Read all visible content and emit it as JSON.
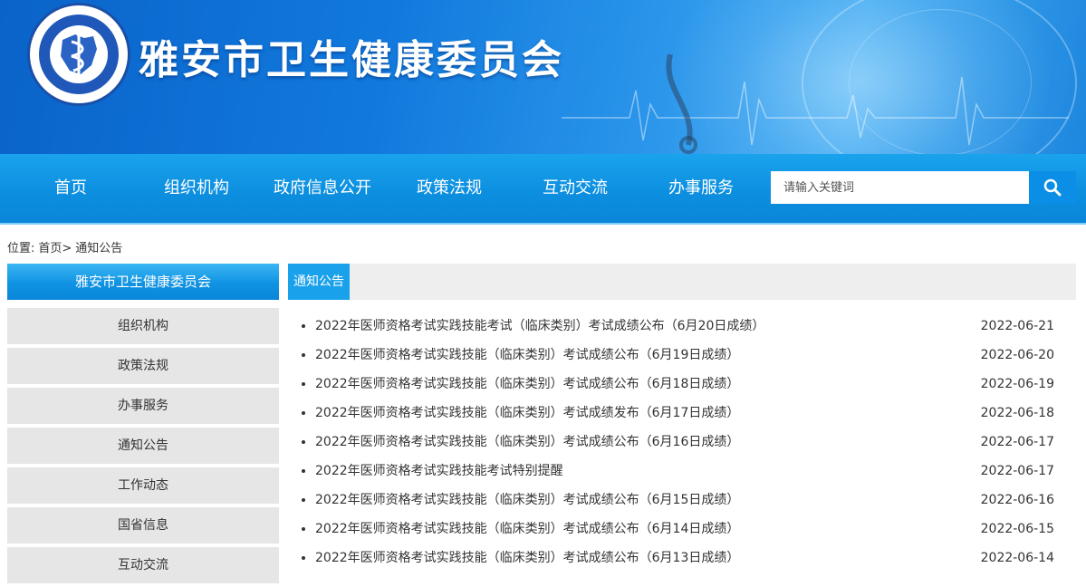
{
  "header": {
    "logo_name": "yaan-health-commission-emblem",
    "title": "雅安市卫生健康委员会"
  },
  "nav": {
    "items": [
      {
        "label": "首页"
      },
      {
        "label": "组织机构"
      },
      {
        "label": "政府信息公开"
      },
      {
        "label": "政策法规"
      },
      {
        "label": "互动交流"
      },
      {
        "label": "办事服务"
      }
    ],
    "search": {
      "placeholder": "请输入关键词",
      "button_icon": "search-icon"
    }
  },
  "breadcrumb": {
    "prefix": "位置:",
    "home": "首页>",
    "current": "通知公告"
  },
  "sidebar": {
    "title": "雅安市卫生健康委员会",
    "items": [
      {
        "label": "组织机构"
      },
      {
        "label": "政策法规"
      },
      {
        "label": "办事服务"
      },
      {
        "label": "通知公告"
      },
      {
        "label": "工作动态"
      },
      {
        "label": "国省信息"
      },
      {
        "label": "互动交流"
      }
    ]
  },
  "main": {
    "section_title": "通知公告",
    "news": [
      {
        "title": "2022年医师资格考试实践技能考试（临床类别）考试成绩公布（6月20日成绩）",
        "date": "2022-06-21"
      },
      {
        "title": "2022年医师资格考试实践技能（临床类别）考试成绩公布（6月19日成绩）",
        "date": "2022-06-20"
      },
      {
        "title": "2022年医师资格考试实践技能（临床类别）考试成绩公布（6月18日成绩）",
        "date": "2022-06-19"
      },
      {
        "title": "2022年医师资格考试实践技能（临床类别）考试成绩发布（6月17日成绩）",
        "date": "2022-06-18"
      },
      {
        "title": "2022年医师资格考试实践技能（临床类别）考试成绩公布（6月16日成绩）",
        "date": "2022-06-17"
      },
      {
        "title": "2022年医师资格考试实践技能考试特别提醒",
        "date": "2022-06-17"
      },
      {
        "title": "2022年医师资格考试实践技能（临床类别）考试成绩公布（6月15日成绩）",
        "date": "2022-06-16"
      },
      {
        "title": "2022年医师资格考试实践技能（临床类别）考试成绩公布（6月14日成绩）",
        "date": "2022-06-15"
      },
      {
        "title": "2022年医师资格考试实践技能（临床类别）考试成绩公布（6月13日成绩）",
        "date": "2022-06-14"
      }
    ]
  },
  "colors": {
    "banner": "#1179dd",
    "nav": "#0d8fe0",
    "accent": "#1aa1eb",
    "sidebar_item_bg": "#e6e6e6"
  }
}
